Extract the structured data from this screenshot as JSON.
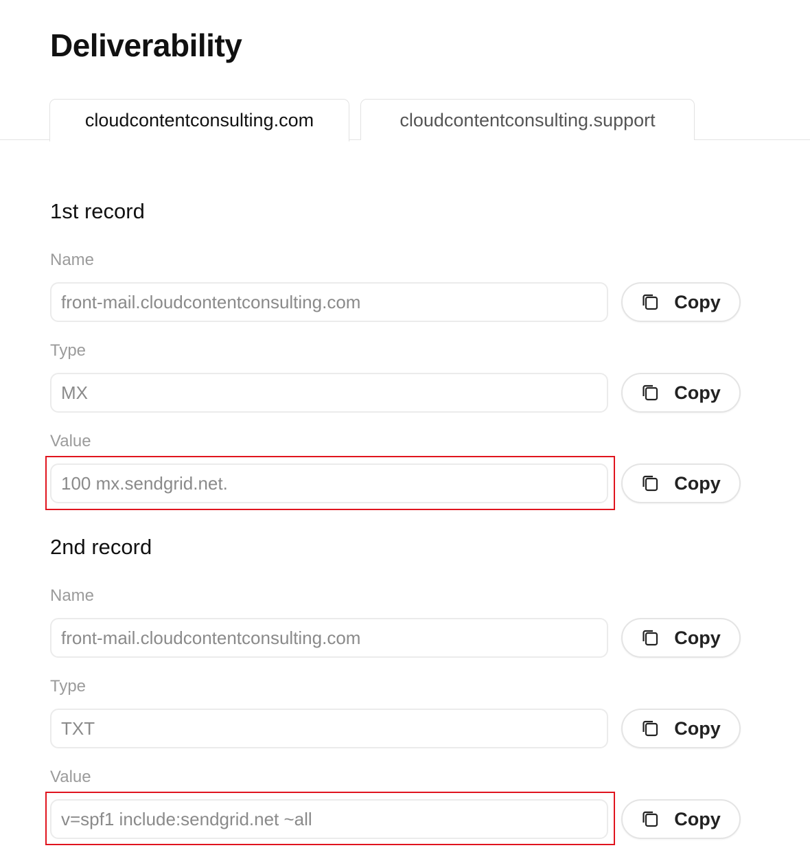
{
  "page": {
    "title": "Deliverability"
  },
  "tabs": [
    {
      "label": "cloudcontentconsulting.com",
      "active": true
    },
    {
      "label": "cloudcontentconsulting.support",
      "active": false
    }
  ],
  "records": [
    {
      "title": "1st record",
      "fields": [
        {
          "label": "Name",
          "value": "front-mail.cloudcontentconsulting.com",
          "copy_label": "Copy"
        },
        {
          "label": "Type",
          "value": "MX",
          "copy_label": "Copy"
        },
        {
          "label": "Value",
          "value": "100 mx.sendgrid.net.",
          "copy_label": "Copy",
          "highlighted": true
        }
      ]
    },
    {
      "title": "2nd record",
      "fields": [
        {
          "label": "Name",
          "value": "front-mail.cloudcontentconsulting.com",
          "copy_label": "Copy"
        },
        {
          "label": "Type",
          "value": "TXT",
          "copy_label": "Copy"
        },
        {
          "label": "Value",
          "value": "v=spf1 include:sendgrid.net ~all",
          "copy_label": "Copy",
          "highlighted": true
        }
      ]
    }
  ],
  "colors": {
    "highlight": "#e0141e",
    "label": "#9b9b9b",
    "input_text": "#8a8a8a"
  },
  "icons": {
    "copy": "copy-icon"
  }
}
